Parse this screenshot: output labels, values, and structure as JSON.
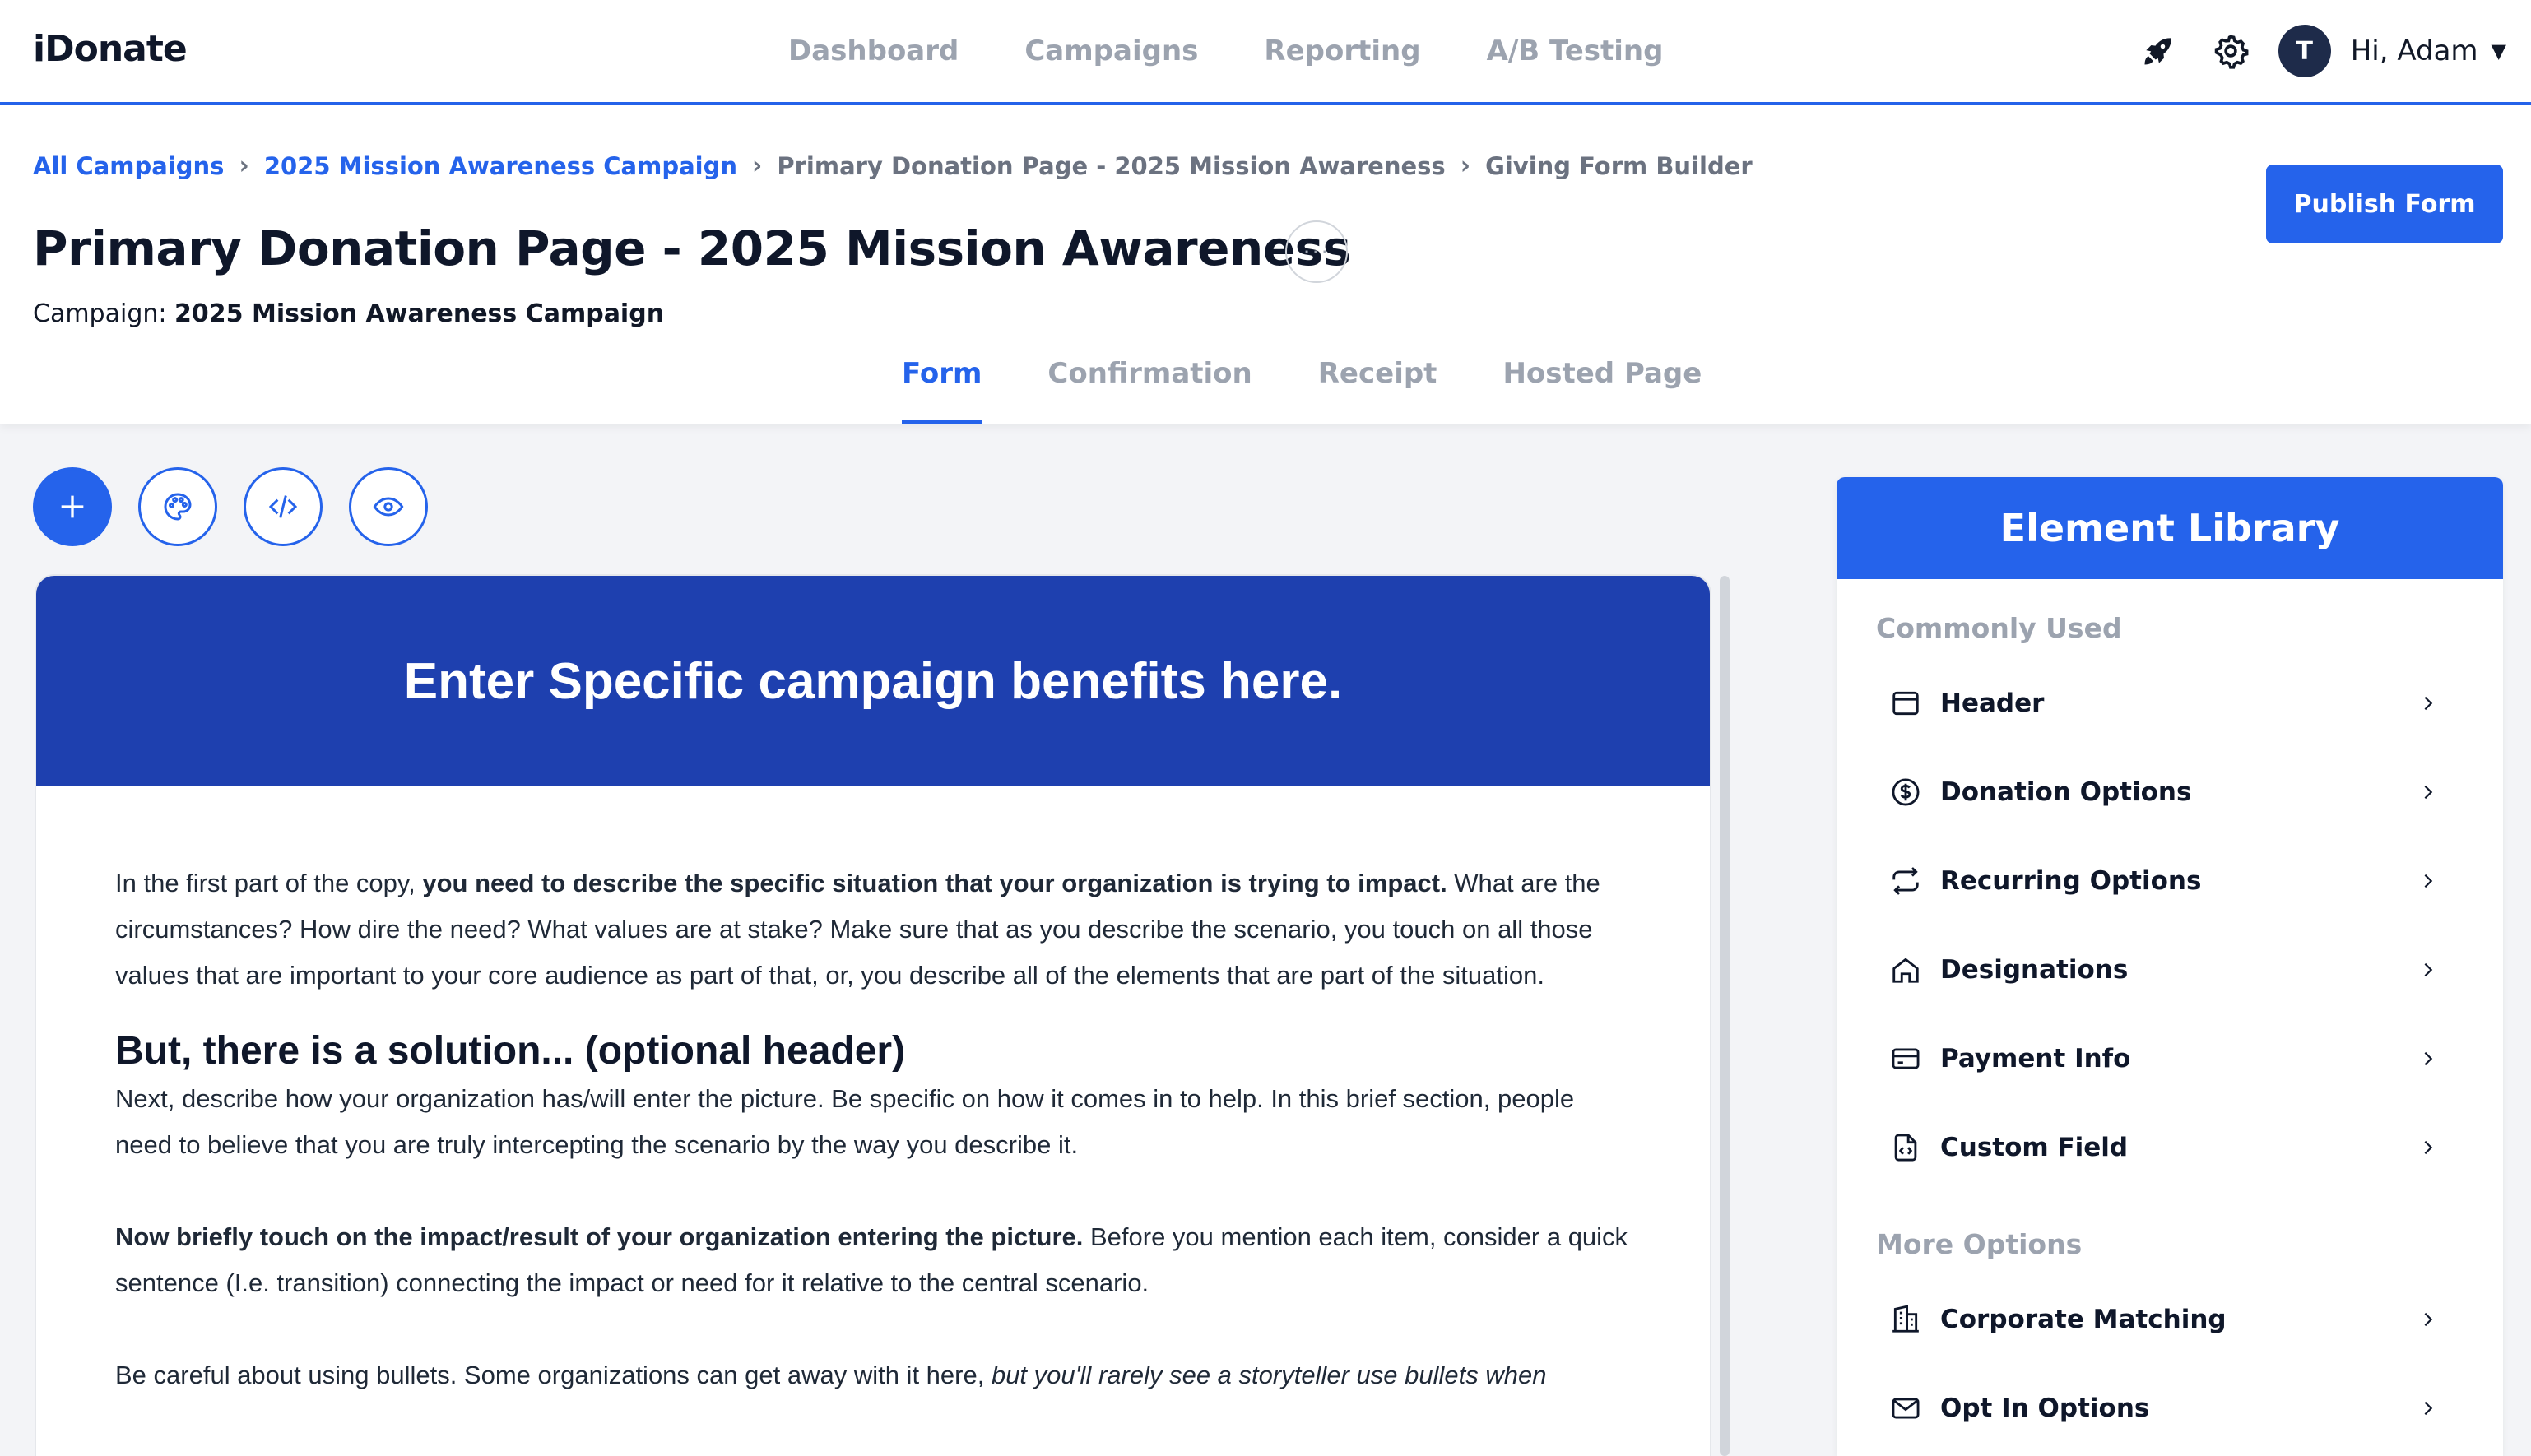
{
  "nav": {
    "logo": "iDonate",
    "items": [
      {
        "label": "Dashboard"
      },
      {
        "label": "Campaigns"
      },
      {
        "label": "Reporting"
      },
      {
        "label": "A/B Testing"
      }
    ],
    "avatar_initial": "T",
    "greeting": "Hi, Adam",
    "icons": [
      "rocket-icon",
      "gear-icon",
      "caret-down-icon"
    ]
  },
  "breadcrumb": {
    "items": [
      {
        "label": "All Campaigns",
        "link": true
      },
      {
        "label": "2025 Mission Awareness Campaign",
        "link": true
      },
      {
        "label": "Primary Donation Page - 2025 Mission Awareness",
        "link": false
      },
      {
        "label": "Giving Form Builder",
        "link": false
      }
    ]
  },
  "page": {
    "title": "Primary Donation Page - 2025 Mission Awareness",
    "more_label": "···",
    "campaign_prefix": "Campaign:",
    "campaign_name": "2025 Mission Awareness Campaign",
    "publish_label": "Publish Form"
  },
  "tabs": [
    {
      "label": "Form",
      "active": true
    },
    {
      "label": "Confirmation",
      "active": false
    },
    {
      "label": "Receipt",
      "active": false
    },
    {
      "label": "Hosted Page",
      "active": false
    }
  ],
  "tools": [
    "plus-icon",
    "palette-icon",
    "code-icon",
    "eye-icon"
  ],
  "form": {
    "banner": "Enter Specific campaign benefits here.",
    "p1_start": "In the first part of the copy, ",
    "p1_bold": "you need to describe the specific situation that your organization is trying to impact.",
    "p1_rest": " What are the circumstances? How dire the need? What values are at stake? Make sure that as you describe the scenario, you touch on all those values that are important to your core audience as part of that, or, you describe all of the elements that are part of the situation.",
    "h2": "But, there is a solution... (optional header)",
    "p2": "Next, describe how your organization has/will enter the picture. Be specific on how it comes in to help. In this brief section, people need to believe that you are truly intercepting the scenario by the way you describe it.",
    "p3_bold": "Now briefly touch on the impact/result of your organization entering the picture.",
    "p3_rest": " Before you mention each item, consider a quick sentence (I.e. transition) connecting the impact or need for it relative to the central scenario.",
    "p4_start": "Be careful about using bullets. Some organizations can get away with it here, ",
    "p4_italic": "but you'll rarely see a storyteller use bullets when"
  },
  "library": {
    "title": "Element Library",
    "section1": "Commonly Used",
    "items1": [
      {
        "label": "Header",
        "icon": "header-icon"
      },
      {
        "label": "Donation Options",
        "icon": "dollar-circle-icon"
      },
      {
        "label": "Recurring Options",
        "icon": "repeat-icon"
      },
      {
        "label": "Designations",
        "icon": "home-icon"
      },
      {
        "label": "Payment Info",
        "icon": "credit-card-icon"
      },
      {
        "label": "Custom Field",
        "icon": "code-file-icon"
      }
    ],
    "section2": "More Options",
    "items2": [
      {
        "label": "Corporate Matching",
        "icon": "building-icon"
      },
      {
        "label": "Opt In Options",
        "icon": "mail-icon"
      }
    ]
  },
  "colors": {
    "accent": "#2563eb",
    "banner": "#1e40af",
    "muted": "#9ca3af",
    "dark": "#0f172a"
  }
}
